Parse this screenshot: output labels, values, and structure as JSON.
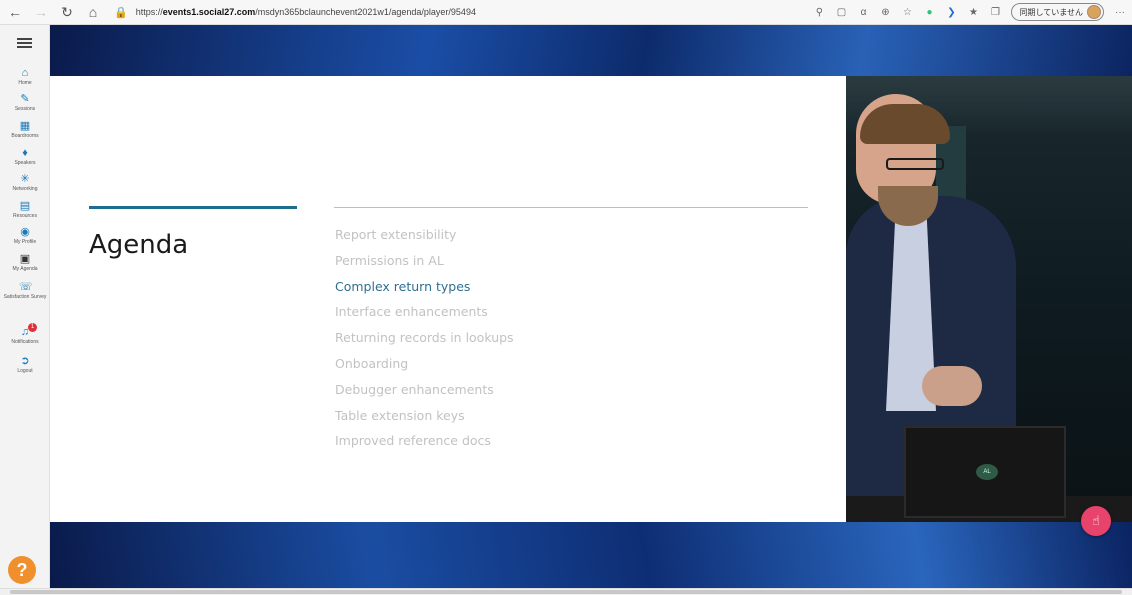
{
  "browser": {
    "url_prefix": "https://",
    "url_host": "events1.social27.com",
    "url_path": "/msdyn365bclaunchevent2021w1/agenda/player/95494",
    "profile_label": "同期していません",
    "more_label": "···"
  },
  "sidebar": {
    "items": [
      {
        "label": "Home",
        "icon": "home-icon"
      },
      {
        "label": "Sessions",
        "icon": "sessions-icon"
      },
      {
        "label": "Boardrooms",
        "icon": "boardrooms-icon"
      },
      {
        "label": "Speakers",
        "icon": "speakers-icon"
      },
      {
        "label": "Networking",
        "icon": "networking-icon"
      },
      {
        "label": "Resources",
        "icon": "resources-icon"
      },
      {
        "label": "My Profile",
        "icon": "profile-icon"
      },
      {
        "label": "My Agenda",
        "icon": "agenda-icon"
      },
      {
        "label": "Satisfaction Survey",
        "icon": "survey-icon"
      },
      {
        "label": "Notifications",
        "icon": "bell-icon",
        "badge": "1"
      },
      {
        "label": "Logout",
        "icon": "logout-icon"
      }
    ],
    "help_label": "?"
  },
  "slide": {
    "title": "Agenda",
    "items": [
      {
        "label": "Report extensibility",
        "active": false
      },
      {
        "label": "Permissions in AL",
        "active": false
      },
      {
        "label": "Complex return types",
        "active": true
      },
      {
        "label": "Interface enhancements",
        "active": false
      },
      {
        "label": "Returning records in lookups",
        "active": false
      },
      {
        "label": "Onboarding",
        "active": false
      },
      {
        "label": "Debugger enhancements",
        "active": false
      },
      {
        "label": "Table extension keys",
        "active": false
      },
      {
        "label": "Improved reference docs",
        "active": false
      }
    ]
  },
  "video": {
    "laptop_logo": "AL"
  },
  "colors": {
    "accent": "#1e6f8c",
    "active_item": "#2f6f8f",
    "inactive_item": "#c2c2c2",
    "like_button": "#e8436a",
    "help_button": "#f0902c"
  }
}
